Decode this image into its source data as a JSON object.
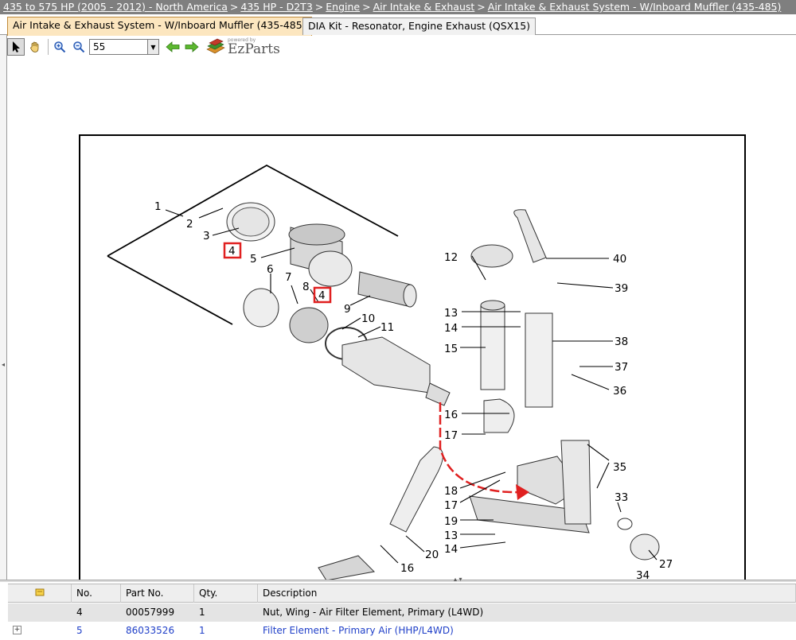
{
  "breadcrumb": [
    "435 to 575 HP (2005 - 2012) - North America",
    "435 HP - D2T3",
    "Engine",
    "Air Intake & Exhaust",
    "Air Intake & Exhaust System - W/Inboard Muffler (435-485)"
  ],
  "breadcrumb_separator": ">",
  "tabs": [
    {
      "label": "Air Intake & Exhaust System - W/Inboard Muffler (435-485)",
      "active": true
    },
    {
      "label": "DIA Kit - Resonator, Engine Exhaust (QSX15)",
      "active": false
    }
  ],
  "toolbar": {
    "zoom_value": "55",
    "brand_small": "powered by",
    "brand_name": "EzParts"
  },
  "diagram": {
    "callouts": [
      "1",
      "2",
      "3",
      "4",
      "5",
      "6",
      "7",
      "8",
      "4",
      "9",
      "10",
      "11",
      "12",
      "13",
      "14",
      "15",
      "16",
      "17",
      "18",
      "17",
      "19",
      "13",
      "14",
      "20",
      "16",
      "40",
      "39",
      "38",
      "37",
      "36",
      "35",
      "33",
      "27",
      "34"
    ],
    "highlighted_callout": "4",
    "highlight_color": "#e02020",
    "arrow_color": "#e02020"
  },
  "parts_table": {
    "columns": [
      "",
      "No.",
      "Part No.",
      "Qty.",
      "Description"
    ],
    "rows": [
      {
        "no": "4",
        "part_no": "00057999",
        "qty": "1",
        "description": "Nut, Wing - Air Filter Element, Primary (L4WD)",
        "selected": true
      },
      {
        "no": "5",
        "part_no": "86033526",
        "qty": "1",
        "description": "Filter Element - Primary Air (HHP/L4WD)",
        "selected": false
      }
    ],
    "expand_symbol": "⊞"
  }
}
